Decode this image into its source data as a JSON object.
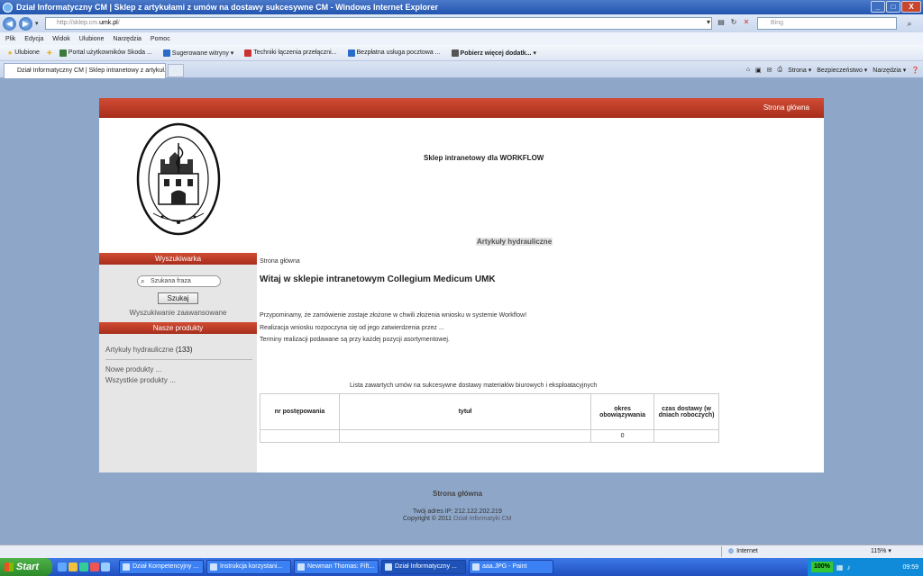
{
  "window": {
    "title": "Dział Informatyczny CM | Sklep z artykułami z umów na dostawy sukcesywne CM - Windows Internet Explorer",
    "min": "_",
    "max": "□",
    "close": "X"
  },
  "address": {
    "url_prefix": "http://sklep.cm.",
    "url_host": "umk.pl",
    "url_suffix": "/",
    "search_placeholder": "Bing"
  },
  "menu": [
    "Plik",
    "Edycja",
    "Widok",
    "Ulubione",
    "Narzędzia",
    "Pomoc"
  ],
  "favorites": {
    "label": "Ulubione",
    "items": [
      {
        "label": "Portal użytkowników Skoda ...",
        "color": "#3a7a3a"
      },
      {
        "label": "Sugerowane witryny ▾",
        "color": "#2a6ac8"
      },
      {
        "label": "Techniki łączenia przełączni...",
        "color": "#c83232"
      },
      {
        "label": "Bezpłatna usługa pocztowa ...",
        "color": "#2a6ac8"
      },
      {
        "label": "Pobierz więcej dodatk... ▾",
        "color": "#555555"
      }
    ]
  },
  "tab": {
    "label": "Dział Informatyczny CM | Sklep intranetowy z artykuł..."
  },
  "commandbar": [
    "Strona ▾",
    "Bezpieczeństwo ▾",
    "Narzędzia ▾"
  ],
  "page": {
    "top_link": "Strona główna",
    "site_title": "Sklep intranetowy dla WORKFLOW",
    "category_link": "Artykuły hydrauliczne",
    "sidebar": {
      "search_header": "Wyszukiwarka",
      "search_placeholder": "Szukana fraza",
      "search_button": "Szukaj",
      "advanced_search": "Wyszukiwanie zaawansowane",
      "products_header": "Nasze produkty",
      "category_name": "Artykuły hydrauliczne",
      "category_count": "(133)",
      "new_products": "Nowe produkty ...",
      "all_products": "Wszystkie produkty ..."
    },
    "breadcrumb": "Strona główna",
    "heading": "Witaj w sklepie intranetowym Collegium Medicum UMK",
    "paragraphs": [
      "Przypominamy, że zamówienie zostaje złożone w chwili złożenia wniosku w systemie Workflow!",
      "Realizacja wniosku rozpoczyna się od jego zatwierdzenia przez ...",
      "Terminy realizacji podawane są przy każdej pozycji asortymentowej."
    ],
    "table_caption": "Lista zawartych umów na sukcesywne dostawy materiałów biurowych i eksploatacyjnych",
    "table_headers": [
      "nr postępowania",
      "tytuł",
      "okres obowiązywania",
      "czas dostawy (w dniach roboczych)"
    ],
    "table_row": [
      "",
      "",
      "0",
      ""
    ],
    "footer_link": "Strona główna",
    "footer_ip": "Twój adres IP: 212.122.202.219",
    "footer_copyright": "Copyright © 2011",
    "footer_dept": "Dział Informatyki CM"
  },
  "status": {
    "zone": "Internet",
    "zoom": "115% ▾"
  },
  "taskbar": {
    "start": "Start",
    "buttons": [
      "Dział Kompetencyjny ...",
      "Instrukcja korzystani...",
      "Newman Thomas: Fift...",
      "Dział Informatyczny ...",
      "aaa.JPG - Paint"
    ],
    "battery": "100%",
    "clock": "09:59"
  }
}
